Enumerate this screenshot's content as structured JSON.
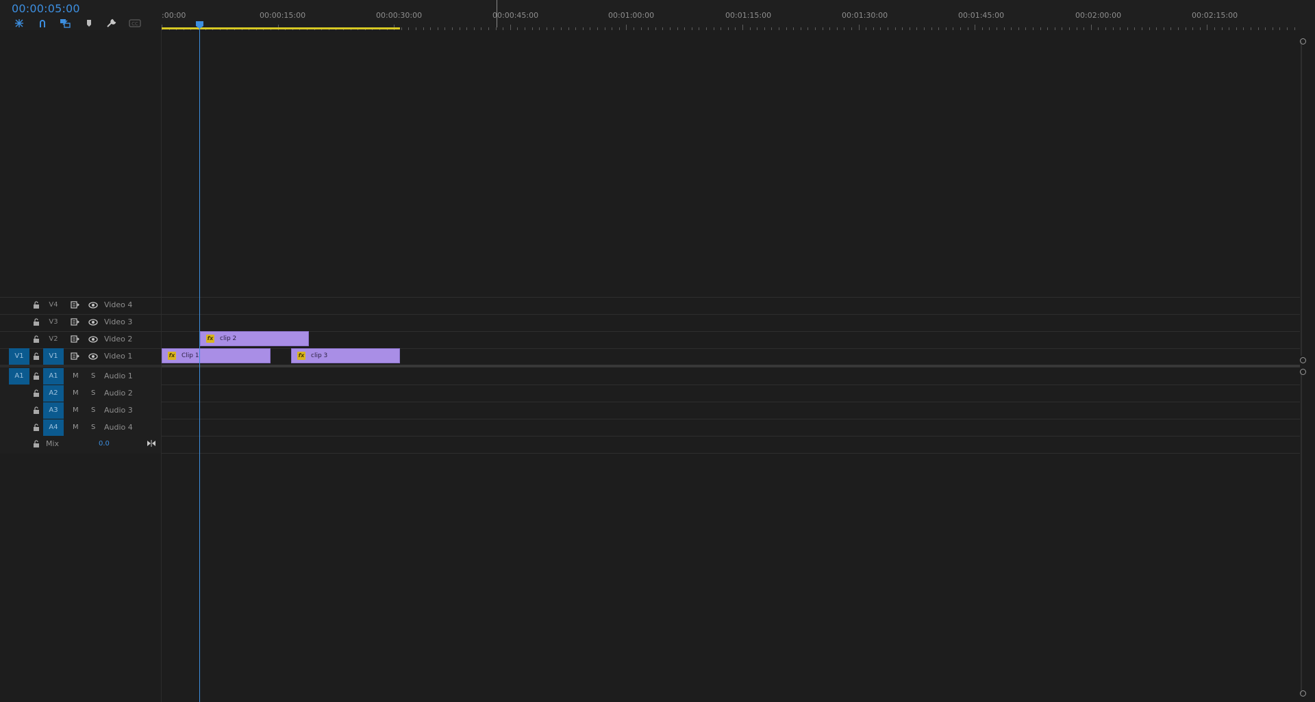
{
  "timecode": "00:00:05:00",
  "toolbar": {
    "tools": [
      {
        "name": "nest-sequence-icon"
      },
      {
        "name": "snap-magnet-icon"
      },
      {
        "name": "linked-selection-icon"
      },
      {
        "name": "add-marker-icon"
      },
      {
        "name": "timeline-settings-wrench-icon"
      },
      {
        "name": "captions-icon"
      }
    ]
  },
  "ruler": {
    "labels": [
      ":00:00",
      "00:00:15:00",
      "00:00:30:00",
      "00:00:45:00",
      "00:01:00:00",
      "00:01:15:00",
      "00:01:30:00",
      "00:01:45:00",
      "00:02:00:00",
      "00:02:15:00"
    ]
  },
  "video_tracks": [
    {
      "id": "V4",
      "name": "Video 4",
      "targeted": false
    },
    {
      "id": "V3",
      "name": "Video 3",
      "targeted": false
    },
    {
      "id": "V2",
      "name": "Video 2",
      "targeted": false
    },
    {
      "id": "V1",
      "name": "Video 1",
      "targeted": true,
      "source": "V1"
    }
  ],
  "audio_tracks": [
    {
      "id": "A1",
      "name": "Audio 1",
      "source": "A1",
      "m": "M",
      "s": "S"
    },
    {
      "id": "A2",
      "name": "Audio 2",
      "m": "M",
      "s": "S"
    },
    {
      "id": "A3",
      "name": "Audio 3",
      "m": "M",
      "s": "S"
    },
    {
      "id": "A4",
      "name": "Audio 4",
      "m": "M",
      "s": "S"
    }
  ],
  "mix": {
    "label": "Mix",
    "value": "0.0"
  },
  "clips": [
    {
      "name": "clip 2",
      "track": "V2",
      "fx": "fx"
    },
    {
      "name": "Clip 1",
      "track": "V1",
      "fx": "fx"
    },
    {
      "name": "clip 3",
      "track": "V1",
      "fx": "fx"
    }
  ],
  "colors": {
    "accent": "#3d8fe0",
    "clip": "#a98ee6",
    "target": "#0b5a8f",
    "inout": "#d8c924"
  }
}
